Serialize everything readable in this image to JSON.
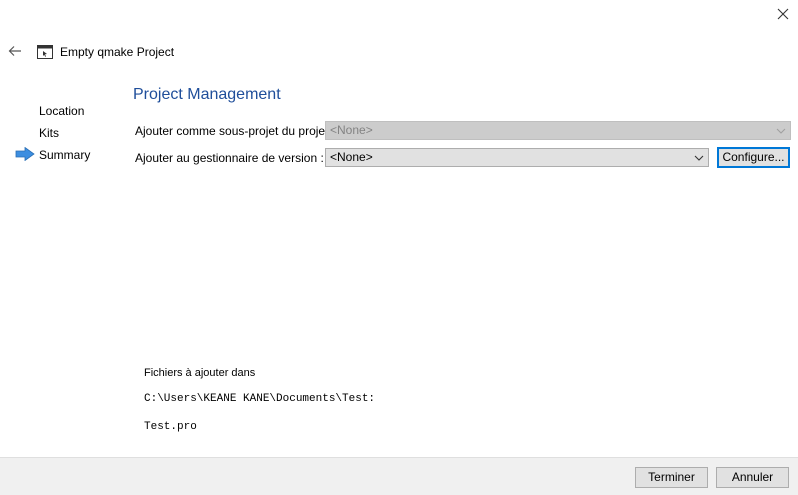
{
  "window": {
    "title": "Empty qmake Project",
    "close_icon": "close-icon",
    "back_icon": "back-arrow-icon",
    "wizard_icon": "qt-project-icon"
  },
  "sidebar": {
    "steps": [
      {
        "label": "Location",
        "current": false
      },
      {
        "label": "Kits",
        "current": false
      },
      {
        "label": "Summary",
        "current": true
      }
    ],
    "current_marker_icon": "arrow-right-icon",
    "current_marker_color": "#3d8ee0"
  },
  "main": {
    "title": "Project Management",
    "title_color": "#1f4e9a",
    "add_subproject": {
      "label": "Ajouter comme sous-projet du projet :",
      "value": "<None>",
      "enabled": false
    },
    "add_vcs": {
      "label": "Ajouter au gestionnaire de version :",
      "value": "<None>",
      "enabled": true
    },
    "configure_label": "Configure...",
    "files": {
      "heading": "Fichiers à ajouter dans",
      "path": "C:\\Users\\KEANE KANE\\Documents\\Test:",
      "file_list": [
        "Test.pro"
      ]
    }
  },
  "footer": {
    "finish_label": "Terminer",
    "cancel_label": "Annuler"
  },
  "colors": {
    "accent": "#0078d7",
    "footer_bg": "#f0f0f0",
    "button_bg": "#e1e1e1"
  }
}
